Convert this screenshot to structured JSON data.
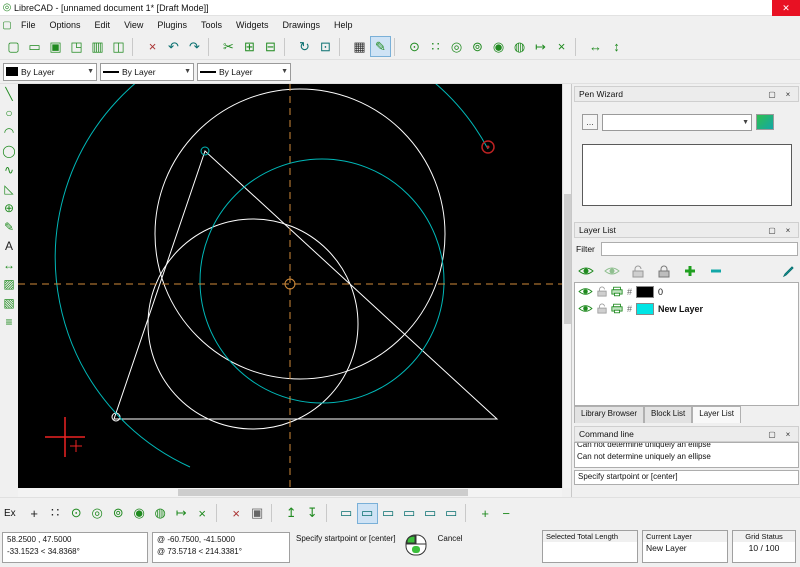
{
  "window": {
    "title": "LibreCAD - [unnamed document 1* [Draft Mode]]"
  },
  "icons": {
    "dock_float": "▢",
    "dock_close": "×",
    "combo_arrow": "▼",
    "option_btn": "…"
  },
  "menu_bar": {
    "items": [
      "File",
      "Options",
      "Edit",
      "View",
      "Plugins",
      "Tools",
      "Widgets",
      "Drawings",
      "Help"
    ]
  },
  "main_toolbar": [
    {
      "name": "new-document-icon",
      "glyph": "▢",
      "color": "#1f8a1f"
    },
    {
      "name": "open-document-icon",
      "glyph": "▭",
      "color": "#1f8a1f"
    },
    {
      "name": "save-icon",
      "glyph": "▣",
      "color": "#1f8a1f"
    },
    {
      "name": "save-as-icon",
      "glyph": "◳",
      "color": "#1f8a1f"
    },
    {
      "name": "print-icon",
      "glyph": "▥",
      "color": "#1f8a1f"
    },
    {
      "name": "print-preview-icon",
      "glyph": "◫",
      "color": "#1f8a1f"
    },
    {
      "sep": true
    },
    {
      "name": "kill-actions-icon",
      "glyph": "×",
      "color": "#aa3333"
    },
    {
      "name": "undo-icon",
      "glyph": "↶",
      "color": "#0a7070"
    },
    {
      "name": "redo-icon",
      "glyph": "↷",
      "color": "#0a7070"
    },
    {
      "sep": true
    },
    {
      "name": "cut-icon",
      "glyph": "✂",
      "color": "#1f8a1f"
    },
    {
      "name": "copy-icon",
      "glyph": "⊞",
      "color": "#1f8a1f"
    },
    {
      "name": "paste-icon",
      "glyph": "⊟",
      "color": "#1f8a1f"
    },
    {
      "sep": true
    },
    {
      "name": "zoom-redraw-icon",
      "glyph": "↻",
      "color": "#0a7070"
    },
    {
      "name": "zoom-window-icon",
      "glyph": "⊡",
      "color": "#0a7070"
    },
    {
      "sep": true
    },
    {
      "name": "grid-toggle-icon",
      "glyph": "▦",
      "color": "#333333"
    },
    {
      "name": "draft-mode-icon",
      "glyph": "✎",
      "color": "#1f8a1f",
      "active": true
    },
    {
      "sep": true
    },
    {
      "name": "snap-free-icon",
      "glyph": "⊙",
      "color": "#1f8a1f"
    },
    {
      "name": "snap-grid-icon",
      "glyph": "∷",
      "color": "#1f8a1f"
    },
    {
      "name": "snap-endpoint-icon",
      "glyph": "◎",
      "color": "#1f8a1f"
    },
    {
      "name": "snap-on-entity-icon",
      "glyph": "⊚",
      "color": "#1f8a1f"
    },
    {
      "name": "snap-center-icon",
      "glyph": "◉",
      "color": "#1f8a1f"
    },
    {
      "name": "snap-middle-icon",
      "glyph": "◍",
      "color": "#1f8a1f"
    },
    {
      "name": "snap-distance-icon",
      "glyph": "↦",
      "color": "#1f8a1f"
    },
    {
      "name": "snap-intersection-icon",
      "glyph": "×",
      "color": "#1f8a1f"
    },
    {
      "sep": true
    },
    {
      "name": "restrict-horizontal-icon",
      "glyph": "↔",
      "color": "#1f8a1f"
    },
    {
      "name": "restrict-vertical-icon",
      "glyph": "↕",
      "color": "#1f8a1f"
    }
  ],
  "pen_toolbar": {
    "color_value": "By Layer",
    "width_value": "By Layer",
    "linetype_value": "By Layer"
  },
  "left_toolbar": [
    {
      "name": "line-icon",
      "glyph": "╲",
      "color": "#1f8a1f"
    },
    {
      "name": "circle-icon",
      "glyph": "○",
      "color": "#1f8a1f"
    },
    {
      "name": "arc-icon",
      "glyph": "◠",
      "color": "#1f8a1f"
    },
    {
      "name": "ellipse-icon",
      "glyph": "◯",
      "color": "#1f8a1f"
    },
    {
      "name": "spline-icon",
      "glyph": "∿",
      "color": "#1f8a1f"
    },
    {
      "name": "polyline-icon",
      "glyph": "◺",
      "color": "#1f8a1f"
    },
    {
      "name": "insert-icon",
      "glyph": "⊕",
      "color": "#1f8a1f"
    },
    {
      "name": "pencil-icon",
      "glyph": "✎",
      "color": "#1f8a1f"
    },
    {
      "name": "text-icon",
      "glyph": "A",
      "color": "#222222"
    },
    {
      "name": "dimension-icon",
      "glyph": "↔",
      "color": "#1f8a1f"
    },
    {
      "name": "hatch-icon",
      "glyph": "▨",
      "color": "#1f8a1f"
    },
    {
      "name": "image-icon",
      "glyph": "▧",
      "color": "#1f8a1f"
    },
    {
      "name": "block-icon",
      "glyph": "≡",
      "color": "#1f8a1f"
    }
  ],
  "canvas": {
    "colors": {
      "background": "#000000",
      "entity": "#ffffff",
      "preview": "#00b8b8",
      "crosshair": "#cf8a3a",
      "cursor": "#ee2222",
      "marker": "#bb2222"
    }
  },
  "pen_wizard": {
    "title": "Pen Wizard",
    "combo_value": ""
  },
  "layer_list": {
    "title": "Layer List",
    "filter_label": "Filter",
    "filter_value": "",
    "layers": [
      {
        "name": "0",
        "color": "#000000"
      },
      {
        "name": "New Layer",
        "color": "#00e5e5"
      }
    ],
    "tabs": [
      {
        "label": "Library Browser"
      },
      {
        "label": "Block List"
      },
      {
        "label": "Layer List"
      }
    ]
  },
  "command_line": {
    "title": "Command line",
    "messages": [
      "Can not determine uniquely an ellipse",
      "Can not determine uniquely an ellipse"
    ],
    "prompt": "Specify startpoint or [center]"
  },
  "bottom_toolbar": {
    "ex_label": "Ex",
    "icons": [
      {
        "name": "relative-zero-icon",
        "glyph": "+",
        "color": "#222222"
      },
      {
        "name": "grid-dots-icon",
        "glyph": "∷",
        "color": "#222222"
      },
      {
        "name": "snap-free-icon",
        "glyph": "⊙",
        "color": "#1f8a1f"
      },
      {
        "name": "snap-endpoint-icon",
        "glyph": "◎",
        "color": "#1f8a1f"
      },
      {
        "name": "snap-on-entity-icon",
        "glyph": "⊚",
        "color": "#1f8a1f"
      },
      {
        "name": "snap-center-icon",
        "glyph": "◉",
        "color": "#1f8a1f"
      },
      {
        "name": "snap-middle-icon",
        "glyph": "◍",
        "color": "#1f8a1f"
      },
      {
        "name": "snap-distance-icon",
        "glyph": "↦",
        "color": "#1f8a1f"
      },
      {
        "name": "snap-intersection-icon",
        "glyph": "×",
        "color": "#1f8a1f"
      },
      {
        "sep": true
      },
      {
        "name": "restrict-nothing-icon",
        "glyph": "×",
        "color": "#aa3333"
      },
      {
        "name": "lock-relative-zero-icon",
        "glyph": "▣",
        "color": "#666666"
      },
      {
        "sep": true
      },
      {
        "name": "restrict-vertical-icon",
        "glyph": "↥",
        "color": "#1f8a1f"
      },
      {
        "name": "restrict-horizontal-icon",
        "glyph": "↧",
        "color": "#1f8a1f"
      },
      {
        "sep": true
      },
      {
        "name": "draw-order-top-icon",
        "glyph": "▭",
        "color": "#0a7070"
      },
      {
        "name": "draw-order-raise-icon",
        "glyph": "▭",
        "color": "#0a7070",
        "active": true
      },
      {
        "name": "draw-order-lower-icon",
        "glyph": "▭",
        "color": "#0a7070"
      },
      {
        "name": "draw-order-bottom-icon",
        "glyph": "▭",
        "color": "#0a7070"
      },
      {
        "name": "fullscreen-icon",
        "glyph": "▭",
        "color": "#0a7070"
      },
      {
        "name": "statusbar-toggle-icon",
        "glyph": "▭",
        "color": "#0a7070"
      },
      {
        "sep": true
      },
      {
        "name": "zoom-in-icon",
        "glyph": "+",
        "color": "#1f8a1f"
      },
      {
        "name": "zoom-out-icon",
        "glyph": "−",
        "color": "#1f8a1f"
      }
    ]
  },
  "status_bar": {
    "abs_line1": "58.2500 , 47.5000",
    "abs_line2": "-33.1523 < 34.8368°",
    "rel_line1": "@ -60.7500, -41.5000",
    "rel_line2": "@ 73.5718 < 214.3381°",
    "hint": "Specify startpoint or [center]",
    "cancel": "Cancel",
    "selected_total_length_label": "Selected Total Length",
    "selected_total_length_value": "",
    "current_layer_label": "Current Layer",
    "current_layer_value": "New Layer",
    "grid_status_label": "Grid Status",
    "grid_status_value": "10 / 100"
  }
}
